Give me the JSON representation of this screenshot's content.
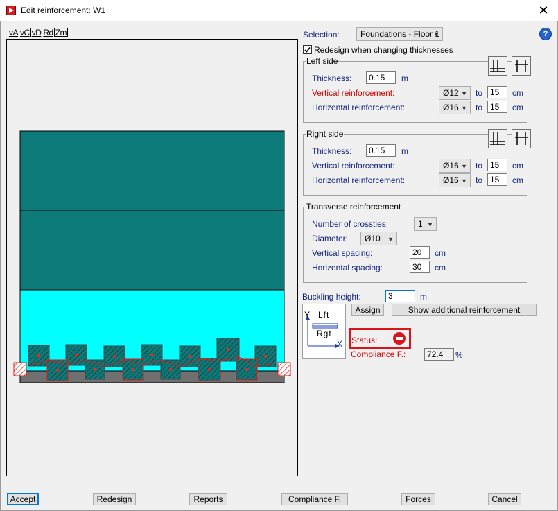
{
  "window": {
    "title": "Edit reinforcement: W1"
  },
  "toolbar": {
    "items": [
      "vA",
      "vC",
      "vD",
      "Rd",
      "Zm"
    ]
  },
  "selection": {
    "label": "Selection:",
    "value": "Foundations - Floor 1"
  },
  "redesign": {
    "label": "Redesign when changing thicknesses",
    "checked": true
  },
  "left_side": {
    "title": "Left side",
    "thickness_label": "Thickness:",
    "thickness": "0.15",
    "thickness_unit": "m",
    "vertical_label": "Vertical reinforcement:",
    "vertical_diameter": "Ø12",
    "vertical_to": "to",
    "vertical_spacing": "15",
    "vertical_unit": "cm",
    "horizontal_label": "Horizontal reinforcement:",
    "horizontal_diameter": "Ø16",
    "horizontal_to": "to",
    "horizontal_spacing": "15",
    "horizontal_unit": "cm"
  },
  "right_side": {
    "title": "Right side",
    "thickness_label": "Thickness:",
    "thickness": "0.15",
    "thickness_unit": "m",
    "vertical_label": "Vertical reinforcement:",
    "vertical_diameter": "Ø16",
    "vertical_to": "to",
    "vertical_spacing": "15",
    "vertical_unit": "cm",
    "horizontal_label": "Horizontal reinforcement:",
    "horizontal_diameter": "Ø16",
    "horizontal_to": "to",
    "horizontal_spacing": "15",
    "horizontal_unit": "cm"
  },
  "transverse": {
    "title": "Transverse reinforcement",
    "crossties_label": "Number of crossties:",
    "crossties": "1",
    "diameter_label": "Diameter:",
    "diameter": "Ø10",
    "vspacing_label": "Vertical spacing:",
    "vspacing": "20",
    "vspacing_unit": "cm",
    "hspacing_label": "Horizontal spacing:",
    "hspacing": "30",
    "hspacing_unit": "cm"
  },
  "buckling": {
    "label": "Buckling height:",
    "value": "3",
    "unit": "m"
  },
  "actions": {
    "assign": "Assign",
    "show_additional": "Show additional reinforcement"
  },
  "section_icon": {
    "y": "Y",
    "lft": "Lft",
    "rgt": "Rgt",
    "x": "X"
  },
  "status": {
    "label": "Status:",
    "icon": "no-entry-icon",
    "color": "#d7151d"
  },
  "compliance": {
    "label": "Compliance F.:",
    "value": "72.4",
    "unit": "%"
  },
  "footer": {
    "accept": "Accept",
    "redesign": "Redesign",
    "reports": "Reports",
    "compliance": "Compliance F.",
    "forces": "Forces",
    "cancel": "Cancel"
  },
  "colors": {
    "wall_teal": "#0b7a78",
    "wall_cyan": "#00ffff",
    "rebar_red": "#e01818",
    "label_blue": "#0d1f7a"
  }
}
